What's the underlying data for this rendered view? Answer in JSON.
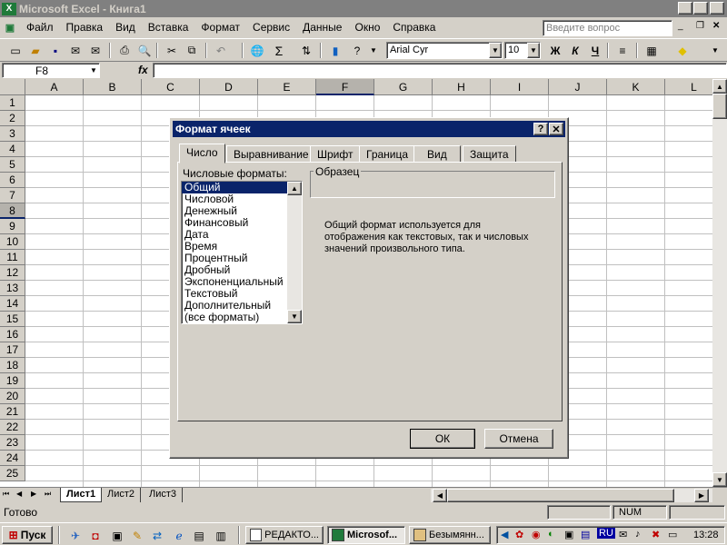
{
  "window": {
    "title": "Microsoft Excel - Книга1"
  },
  "menu": {
    "items": [
      "Файл",
      "Правка",
      "Вид",
      "Вставка",
      "Формат",
      "Сервис",
      "Данные",
      "Окно",
      "Справка"
    ],
    "help_placeholder": "Введите вопрос"
  },
  "toolbar": {
    "font": "Arial Cyr",
    "size": "10",
    "bold": "Ж",
    "italic": "К",
    "underline": "Ч",
    "sum": "Σ"
  },
  "formula_bar": {
    "cell": "F8",
    "fx": "fx",
    "value": ""
  },
  "grid": {
    "columns": [
      "A",
      "B",
      "C",
      "D",
      "E",
      "F",
      "G",
      "H",
      "I",
      "J",
      "K",
      "L"
    ],
    "rows": [
      "1",
      "2",
      "3",
      "4",
      "5",
      "6",
      "7",
      "8",
      "9",
      "10",
      "11",
      "12",
      "13",
      "14",
      "15",
      "16",
      "17",
      "18",
      "19",
      "20",
      "21",
      "22",
      "23",
      "24",
      "25"
    ],
    "selected_col": "F",
    "selected_row": "8"
  },
  "sheets": {
    "tabs": [
      "Лист1",
      "Лист2",
      "Лист3"
    ],
    "active": "Лист1"
  },
  "status": {
    "text": "Готово",
    "num": "NUM"
  },
  "dialog": {
    "title": "Формат ячеек",
    "help": "?",
    "close": "✕",
    "tabs": [
      "Число",
      "Выравнивание",
      "Шрифт",
      "Граница",
      "Вид",
      "Защита"
    ],
    "active_tab": "Число",
    "list_label": "Числовые форматы:",
    "formats": [
      "Общий",
      "Числовой",
      "Денежный",
      "Финансовый",
      "Дата",
      "Время",
      "Процентный",
      "Дробный",
      "Экспоненциальный",
      "Текстовый",
      "Дополнительный",
      "(все форматы)"
    ],
    "selected_format": "Общий",
    "sample_label": "Образец",
    "description": "Общий формат используется для отображения как текстовых, так и числовых значений произвольного типа.",
    "ok": "ОК",
    "cancel": "Отмена"
  },
  "taskbar": {
    "start": "Пуск",
    "tasks": [
      "РЕДАКТО...",
      "Microsof...",
      "Безымянн..."
    ],
    "active_task": "Microsof...",
    "lang": "RU",
    "clock": "13:28"
  }
}
